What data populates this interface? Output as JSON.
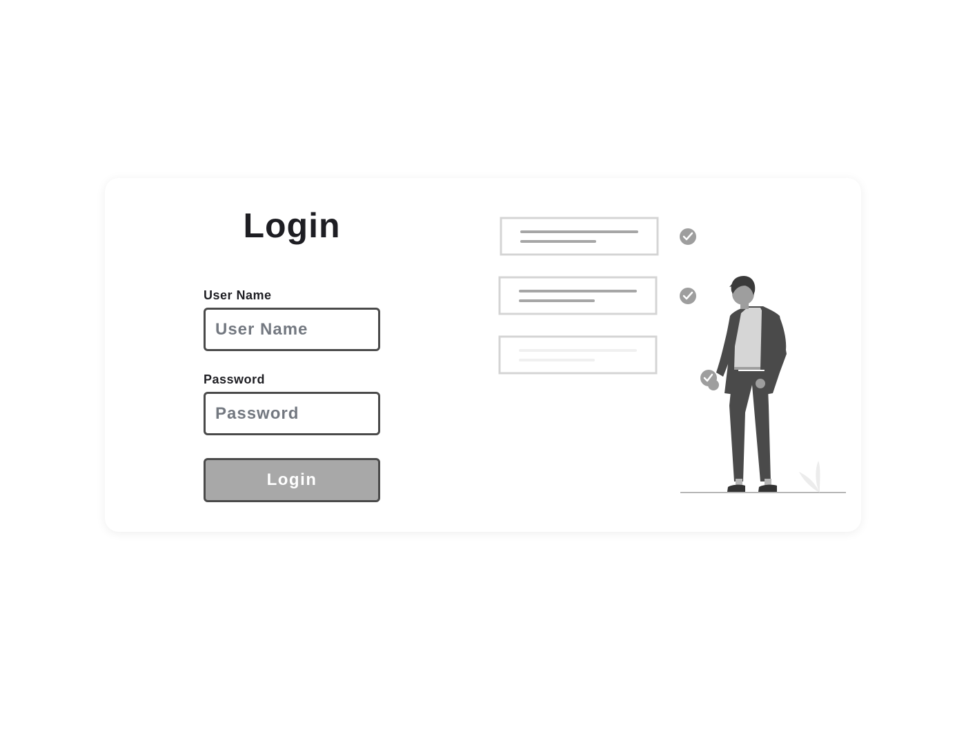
{
  "login_form": {
    "title": "Login",
    "username_label": "User Name",
    "username_placeholder": "User Name",
    "username_value": "",
    "password_label": "Password",
    "password_placeholder": "Password",
    "password_value": "",
    "submit_label": "Login"
  },
  "illustration": {
    "icon": "person-with-checklist-icon"
  },
  "colors": {
    "button_fill": "#a8a8a8",
    "input_border": "#4a4a4a",
    "title_text": "#1e1e23",
    "placeholder_text": "#737880"
  }
}
